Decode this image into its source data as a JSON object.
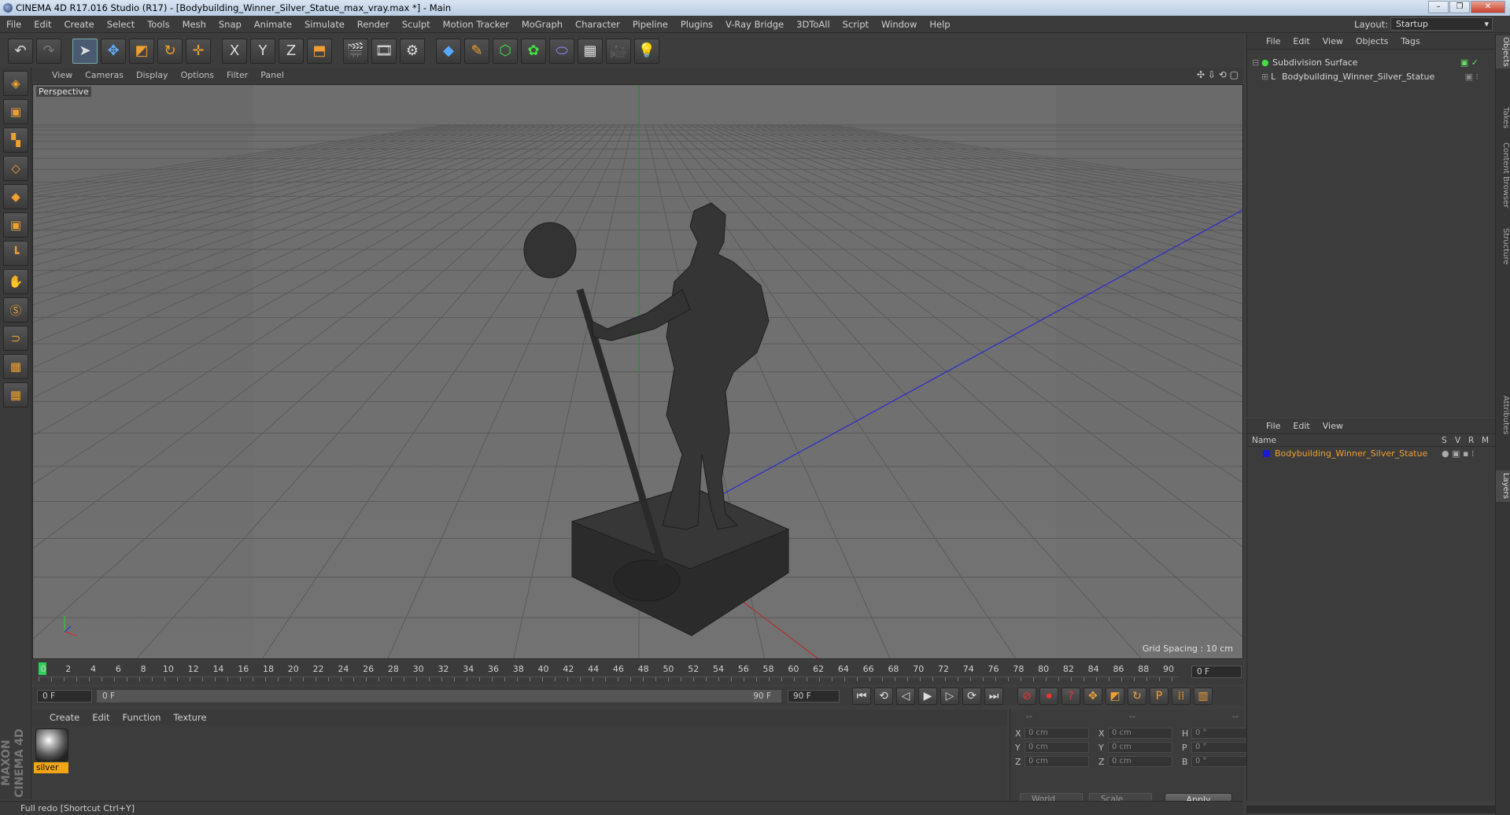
{
  "window": {
    "title": "CINEMA 4D R17.016 Studio (R17) - [Bodybuilding_Winner_Silver_Statue_max_vray.max *] - Main",
    "minimize": "–",
    "maximize": "❐",
    "close": "✕"
  },
  "menubar": [
    "File",
    "Edit",
    "Create",
    "Select",
    "Tools",
    "Mesh",
    "Snap",
    "Animate",
    "Simulate",
    "Render",
    "Sculpt",
    "Motion Tracker",
    "MoGraph",
    "Character",
    "Pipeline",
    "Plugins",
    "V-Ray Bridge",
    "3DToAll",
    "Script",
    "Window",
    "Help"
  ],
  "layout": {
    "label": "Layout:",
    "value": "Startup"
  },
  "toolbar": {
    "undo": "↶",
    "redo": "↷",
    "select": "➤",
    "move": "✥",
    "scale": "◩",
    "rotate": "↻",
    "transform": "✛",
    "x": "X",
    "y": "Y",
    "z": "Z",
    "coord": "⬒",
    "render_view": "🎬",
    "render_active": "🎞",
    "render_settings": "⚙",
    "cube": "◆",
    "pen": "✎",
    "subdiv": "⬡",
    "mograph": "✿",
    "deformer": "⬭",
    "floor": "▦",
    "camera": "🎥",
    "light": "💡"
  },
  "lefttools": [
    "◈",
    "▣",
    "▚",
    "◇",
    "◆",
    "▣",
    "┗",
    "✋",
    "Ⓢ",
    "⊃",
    "▦",
    "▦"
  ],
  "viewport": {
    "menu": [
      "View",
      "Cameras",
      "Display",
      "Options",
      "Filter",
      "Panel"
    ],
    "label": "Perspective",
    "grid_spacing": "Grid Spacing : 10 cm",
    "nav_icons": "✣ ⇩ ⟲ ▢"
  },
  "timeline": {
    "ticks": [
      "0",
      "2",
      "4",
      "6",
      "8",
      "10",
      "12",
      "14",
      "16",
      "18",
      "20",
      "22",
      "24",
      "26",
      "28",
      "30",
      "32",
      "34",
      "36",
      "38",
      "40",
      "42",
      "44",
      "46",
      "48",
      "50",
      "52",
      "54",
      "56",
      "58",
      "60",
      "62",
      "64",
      "66",
      "68",
      "70",
      "72",
      "74",
      "76",
      "78",
      "80",
      "82",
      "84",
      "86",
      "88",
      "90"
    ],
    "current_frame": "0 F",
    "start_field": "0 F",
    "range_start": "0 F",
    "range_end": "90 F",
    "end_field": "90 F"
  },
  "transport": [
    "⏮",
    "⟲",
    "◁",
    "▶",
    "▷",
    "⟳",
    "⏭"
  ],
  "anim_tools": [
    "⊘",
    "⏺",
    "?",
    "✥",
    "◩",
    "↻",
    "P",
    "⁞⁞",
    "▥"
  ],
  "material_manager": {
    "menu": [
      "Create",
      "Edit",
      "Function",
      "Texture"
    ],
    "materials": [
      {
        "name": "silver"
      }
    ]
  },
  "coordinates": {
    "headers": [
      "--",
      "--",
      "--"
    ],
    "rows": [
      {
        "a": "X",
        "av": "0 cm",
        "b": "X",
        "bv": "0 cm",
        "c": "H",
        "cv": "0 °"
      },
      {
        "a": "Y",
        "av": "0 cm",
        "b": "Y",
        "bv": "0 cm",
        "c": "P",
        "cv": "0 °"
      },
      {
        "a": "Z",
        "av": "0 cm",
        "b": "Z",
        "bv": "0 cm",
        "c": "B",
        "cv": "0 °"
      }
    ],
    "mode": "World",
    "scale": "Scale",
    "apply": "Apply"
  },
  "status": "Full redo [Shortcut Ctrl+Y]",
  "maxon": "MAXON CINEMA 4D",
  "object_manager": {
    "menu": [
      "File",
      "Edit",
      "View",
      "Objects",
      "Tags"
    ],
    "objects": [
      {
        "name": "Subdivision Surface"
      },
      {
        "name": "Bodybuilding_Winner_Silver_Statue"
      }
    ]
  },
  "layer_manager": {
    "menu": [
      "File",
      "Edit",
      "View"
    ],
    "columns": {
      "name": "Name",
      "s": "S",
      "v": "V",
      "r": "R",
      "m": "M"
    },
    "layers": [
      {
        "name": "Bodybuilding_Winner_Silver_Statue",
        "color": "#1a1ad6"
      }
    ]
  },
  "side_tabs": [
    "Objects",
    "Takes",
    "Content Browser",
    "Structure",
    "Attributes",
    "Layers"
  ],
  "colors": {
    "accent": "#f2a516",
    "layer_text": "#f0a030"
  }
}
